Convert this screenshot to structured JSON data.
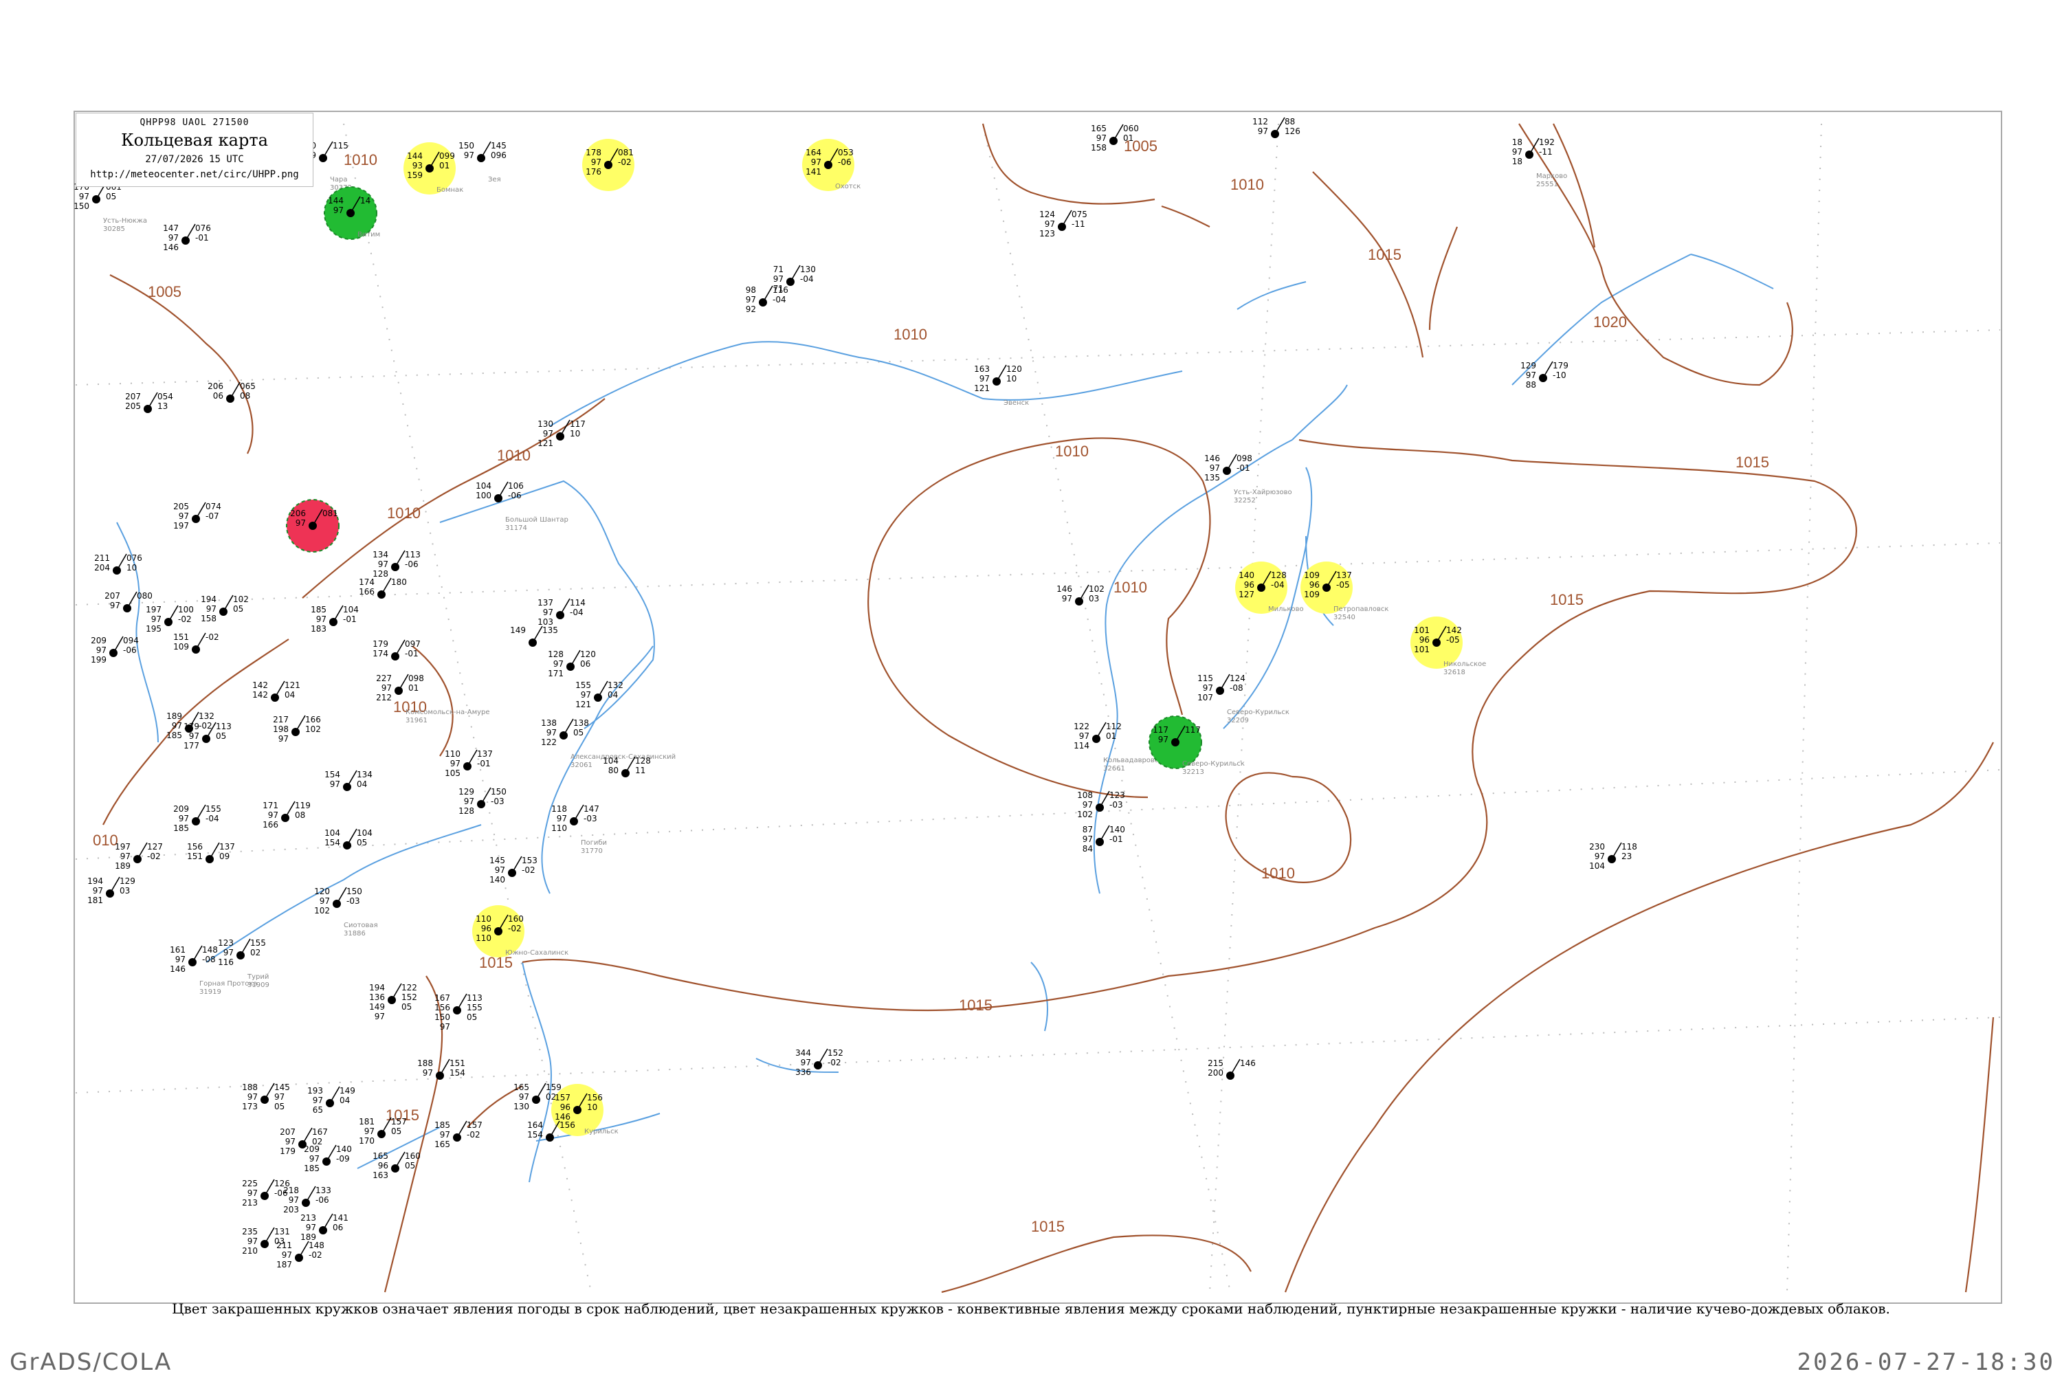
{
  "header": {
    "code": "QHPP98  UAOL  271500",
    "title": "Кольцевая карта",
    "date": "27/07/2026 15 UTC",
    "url": "http://meteocenter.net/circ/UHPP.png"
  },
  "caption": "Цвет закрашенных кружков означает явления погоды в срок наблюдений, цвет незакрашенных кружков - конвективные явления между сроками наблюдений, пунктирные незакрашенные кружки - наличие кучево-дождевых облаков.",
  "footer": {
    "left": "GrADS/COLA",
    "right": "2026-07-27-18:30"
  },
  "colors": {
    "coast": "#5aa0e0",
    "isobar": "#a0522d",
    "green": "#22bb33",
    "yellow": "#ffff66",
    "red": "#ee3355",
    "frame": "#aaaaaa",
    "station_name": "#888888"
  },
  "isobar_labels": [
    "1005",
    "1010",
    "1015",
    "1020",
    "010"
  ],
  "stations": [
    {
      "name": "Усть-Нюкжа",
      "index": "30285",
      "values": [
        "170",
        "97",
        "150",
        "061",
        "05"
      ],
      "marker": "none"
    },
    {
      "name": "",
      "index": "",
      "values": [
        "147",
        "97",
        "146",
        "076",
        "-01"
      ],
      "marker": "none"
    },
    {
      "name": "Чара",
      "index": "30372",
      "values": [
        "140",
        "09",
        "115"
      ],
      "marker": "none"
    },
    {
      "name": "Витим",
      "index": "",
      "values": [
        "144",
        "97",
        "14"
      ],
      "marker": "green"
    },
    {
      "name": "Бомнак",
      "index": "",
      "values": [
        "144",
        "93",
        "159",
        "099",
        "01"
      ],
      "marker": "yellow"
    },
    {
      "name": "Зея",
      "index": "",
      "values": [
        "150",
        "97",
        "145",
        "096"
      ],
      "marker": "none"
    },
    {
      "name": "",
      "index": "",
      "values": [
        "178",
        "97",
        "176",
        "081",
        "-02"
      ],
      "marker": "yellow"
    },
    {
      "name": "Охотск",
      "index": "",
      "values": [
        "164",
        "97",
        "141",
        "053",
        "-06"
      ],
      "marker": "yellow"
    },
    {
      "name": "",
      "index": "",
      "values": [
        "165",
        "97",
        "158",
        "060",
        "01"
      ],
      "marker": "none"
    },
    {
      "name": "",
      "index": "",
      "values": [
        "112",
        "97",
        "88",
        "126"
      ],
      "marker": "none"
    },
    {
      "name": "Марково",
      "index": "25551",
      "values": [
        "18",
        "97",
        "18",
        "192",
        "-11"
      ],
      "marker": "none"
    },
    {
      "name": "",
      "index": "",
      "values": [
        "124",
        "97",
        "123",
        "075",
        "-11"
      ],
      "marker": "none"
    },
    {
      "name": "",
      "index": "",
      "values": [
        "71",
        "97",
        "71",
        "130",
        "-04"
      ],
      "marker": "none"
    },
    {
      "name": "",
      "index": "",
      "values": [
        "98",
        "97",
        "92",
        "116",
        "-04"
      ],
      "marker": "none"
    },
    {
      "name": "Эвенск",
      "index": "",
      "values": [
        "163",
        "97",
        "121",
        "120",
        "10"
      ],
      "marker": "none"
    },
    {
      "name": "",
      "index": "",
      "values": [
        "129",
        "97",
        "88",
        "179",
        "-10"
      ],
      "marker": "none"
    },
    {
      "name": "",
      "index": "",
      "values": [
        "207",
        "205",
        "054",
        "13"
      ],
      "marker": "none"
    },
    {
      "name": "",
      "index": "",
      "values": [
        "206",
        "06",
        "065",
        "08"
      ],
      "marker": "none"
    },
    {
      "name": "",
      "index": "",
      "values": [
        "130",
        "97",
        "121",
        "117",
        "10"
      ],
      "marker": "none"
    },
    {
      "name": "Большой Шантар",
      "index": "31174",
      "values": [
        "104",
        "100",
        "106",
        "-06"
      ],
      "marker": "none"
    },
    {
      "name": "Усть-Хайрюзово",
      "index": "32252",
      "values": [
        "146",
        "97",
        "135",
        "098",
        "-01"
      ],
      "marker": "none"
    },
    {
      "name": "",
      "index": "",
      "values": [
        "205",
        "97",
        "197",
        "074",
        "-07"
      ],
      "marker": "none"
    },
    {
      "name": "",
      "index": "",
      "values": [
        "206",
        "97",
        "081"
      ],
      "marker": "red"
    },
    {
      "name": "",
      "index": "",
      "values": [
        "134",
        "97",
        "128",
        "113",
        "-06"
      ],
      "marker": "none"
    },
    {
      "name": "",
      "index": "",
      "values": [
        "211",
        "204",
        "076",
        "10"
      ],
      "marker": "none"
    },
    {
      "name": "",
      "index": "",
      "values": [
        "207",
        "97",
        "080"
      ],
      "marker": "none"
    },
    {
      "name": "",
      "index": "",
      "values": [
        "197",
        "97",
        "195",
        "100",
        "-02"
      ],
      "marker": "none"
    },
    {
      "name": "",
      "index": "",
      "values": [
        "194",
        "97",
        "158",
        "102",
        "05"
      ],
      "marker": "none"
    },
    {
      "name": "",
      "index": "",
      "values": [
        "174",
        "166",
        "180"
      ],
      "marker": "none"
    },
    {
      "name": "",
      "index": "",
      "values": [
        "137",
        "97",
        "103",
        "114",
        "-04"
      ],
      "marker": "none"
    },
    {
      "name": "",
      "index": "",
      "values": [
        "149",
        "135"
      ],
      "marker": "none"
    },
    {
      "name": "Мильково",
      "index": "",
      "values": [
        "140",
        "96",
        "127",
        "128",
        "-04"
      ],
      "marker": "yellow"
    },
    {
      "name": "Петропавловск",
      "index": "32540",
      "values": [
        "109",
        "96",
        "109",
        "137",
        "-05"
      ],
      "marker": "yellow"
    },
    {
      "name": "",
      "index": "",
      "values": [
        "146",
        "97",
        "102",
        "03"
      ],
      "marker": "none"
    },
    {
      "name": "Никольское",
      "index": "32618",
      "values": [
        "101",
        "96",
        "101",
        "142",
        "-05"
      ],
      "marker": "yellow"
    },
    {
      "name": "",
      "index": "",
      "values": [
        "209",
        "97",
        "199",
        "094",
        "-06"
      ],
      "marker": "none"
    },
    {
      "name": "",
      "index": "",
      "values": [
        "151",
        "109",
        "-02"
      ],
      "marker": "none"
    },
    {
      "name": "",
      "index": "",
      "values": [
        "185",
        "97",
        "183",
        "104",
        "-01"
      ],
      "marker": "none"
    },
    {
      "name": "",
      "index": "",
      "values": [
        "179",
        "174",
        "097",
        "-01"
      ],
      "marker": "none"
    },
    {
      "name": "",
      "index": "",
      "values": [
        "128",
        "97",
        "171",
        "120",
        "06"
      ],
      "marker": "none"
    },
    {
      "name": "Северо-Курильск",
      "index": "32209",
      "values": [
        "115",
        "97",
        "107",
        "124",
        "-08"
      ],
      "marker": "none"
    },
    {
      "name": "",
      "index": "",
      "values": [
        "142",
        "142",
        "121",
        "04"
      ],
      "marker": "none"
    },
    {
      "name": "Комсомольск-на-Амуре",
      "index": "31961",
      "values": [
        "227",
        "97",
        "212",
        "098",
        "01"
      ],
      "marker": "none"
    },
    {
      "name": "",
      "index": "",
      "values": [
        "155",
        "97",
        "121",
        "132",
        "04"
      ],
      "marker": "none"
    },
    {
      "name": "",
      "index": "",
      "values": [
        "189",
        "97",
        "185",
        "132",
        "-02"
      ],
      "marker": "none"
    },
    {
      "name": "",
      "index": "",
      "values": [
        "179",
        "97",
        "177",
        "113",
        "05"
      ],
      "marker": "none"
    },
    {
      "name": "",
      "index": "",
      "values": [
        "217",
        "198",
        "97",
        "166",
        "102"
      ],
      "marker": "none"
    },
    {
      "name": "",
      "index": "",
      "values": [
        "154",
        "97",
        "134",
        "04"
      ],
      "marker": "none"
    },
    {
      "name": "Александровск-Сахалинский",
      "index": "32061",
      "values": [
        "138",
        "97",
        "122",
        "138",
        "05"
      ],
      "marker": "none"
    },
    {
      "name": "",
      "index": "",
      "values": [
        "104",
        "80",
        "128",
        "11"
      ],
      "marker": "none"
    },
    {
      "name": "Кольвадаврово",
      "index": "32661",
      "values": [
        "122",
        "97",
        "114",
        "112",
        "01"
      ],
      "marker": "none"
    },
    {
      "name": "Северо-Курильск",
      "index": "32213",
      "values": [
        "117",
        "97",
        "117"
      ],
      "marker": "green"
    },
    {
      "name": "",
      "index": "",
      "values": [
        "110",
        "97",
        "105",
        "137",
        "-01"
      ],
      "marker": "none"
    },
    {
      "name": "",
      "index": "",
      "values": [
        "209",
        "97",
        "185",
        "155",
        "-04"
      ],
      "marker": "none"
    },
    {
      "name": "",
      "index": "",
      "values": [
        "171",
        "97",
        "166",
        "119",
        "08"
      ],
      "marker": "none"
    },
    {
      "name": "",
      "index": "",
      "values": [
        "129",
        "97",
        "128",
        "150",
        "-03"
      ],
      "marker": "none"
    },
    {
      "name": "Погиби",
      "index": "31770",
      "values": [
        "118",
        "97",
        "110",
        "147",
        "-03"
      ],
      "marker": "none"
    },
    {
      "name": "",
      "index": "",
      "values": [
        "108",
        "97",
        "102",
        "123",
        "-03"
      ],
      "marker": "none"
    },
    {
      "name": "",
      "index": "",
      "values": [
        "87",
        "97",
        "84",
        "140",
        "-01"
      ],
      "marker": "none"
    },
    {
      "name": "",
      "index": "",
      "values": [
        "197",
        "97",
        "189",
        "127",
        "-02"
      ],
      "marker": "none"
    },
    {
      "name": "",
      "index": "",
      "values": [
        "156",
        "151",
        "137",
        "09"
      ],
      "marker": "none"
    },
    {
      "name": "",
      "index": "",
      "values": [
        "104",
        "154",
        "104",
        "05"
      ],
      "marker": "none"
    },
    {
      "name": "",
      "index": "",
      "values": [
        "145",
        "97",
        "140",
        "153",
        "-02"
      ],
      "marker": "none"
    },
    {
      "name": "",
      "index": "",
      "values": [
        "230",
        "97",
        "104",
        "118",
        "23"
      ],
      "marker": "none"
    },
    {
      "name": "",
      "index": "",
      "values": [
        "194",
        "97",
        "181",
        "129",
        "03"
      ],
      "marker": "none"
    },
    {
      "name": "Сиотовая",
      "index": "31886",
      "values": [
        "120",
        "97",
        "102",
        "150",
        "-03"
      ],
      "marker": "none"
    },
    {
      "name": "Южно-Сахалинск",
      "index": "",
      "values": [
        "110",
        "96",
        "110",
        "160",
        "-02"
      ],
      "marker": "yellow"
    },
    {
      "name": "Горная Протока",
      "index": "31919",
      "values": [
        "161",
        "97",
        "146",
        "148",
        "-08"
      ],
      "marker": "none"
    },
    {
      "name": "Турий",
      "index": "31909",
      "values": [
        "123",
        "97",
        "116",
        "155",
        "02"
      ],
      "marker": "none"
    },
    {
      "name": "",
      "index": "",
      "values": [
        "194",
        "136",
        "149",
        "97",
        "122",
        "152",
        "05"
      ],
      "marker": "none"
    },
    {
      "name": "",
      "index": "",
      "values": [
        "167",
        "156",
        "150",
        "97",
        "113",
        "155",
        "05"
      ],
      "marker": "none"
    },
    {
      "name": "",
      "index": "",
      "values": [
        "344",
        "97",
        "336",
        "152",
        "-02"
      ],
      "marker": "none"
    },
    {
      "name": "",
      "index": "",
      "values": [
        "215",
        "200",
        "146"
      ],
      "marker": "none"
    },
    {
      "name": "",
      "index": "",
      "values": [
        "188",
        "97",
        "151",
        "154"
      ],
      "marker": "none"
    },
    {
      "name": "Курильск",
      "index": "",
      "values": [
        "157",
        "96",
        "146",
        "156",
        "10"
      ],
      "marker": "yellow"
    },
    {
      "name": "",
      "index": "",
      "values": [
        "165",
        "97",
        "130",
        "159",
        "02"
      ],
      "marker": "none"
    },
    {
      "name": "",
      "index": "",
      "values": [
        "188",
        "97",
        "173",
        "145",
        "97",
        "05"
      ],
      "marker": "none"
    },
    {
      "name": "",
      "index": "",
      "values": [
        "193",
        "97",
        "65",
        "149",
        "04"
      ],
      "marker": "none"
    },
    {
      "name": "",
      "index": "",
      "values": [
        "207",
        "97",
        "179",
        "167",
        "02"
      ],
      "marker": "none"
    },
    {
      "name": "",
      "index": "",
      "values": [
        "209",
        "97",
        "185",
        "140",
        "-09"
      ],
      "marker": "none"
    },
    {
      "name": "",
      "index": "",
      "values": [
        "181",
        "97",
        "170",
        "157",
        "05"
      ],
      "marker": "none"
    },
    {
      "name": "",
      "index": "",
      "values": [
        "185",
        "97",
        "165",
        "157",
        "-02"
      ],
      "marker": "none"
    },
    {
      "name": "",
      "index": "",
      "values": [
        "164",
        "154",
        "156"
      ],
      "marker": "none"
    },
    {
      "name": "",
      "index": "",
      "values": [
        "165",
        "96",
        "163",
        "160",
        "05"
      ],
      "marker": "none"
    },
    {
      "name": "",
      "index": "",
      "values": [
        "225",
        "97",
        "213",
        "126",
        "-06"
      ],
      "marker": "none"
    },
    {
      "name": "",
      "index": "",
      "values": [
        "218",
        "97",
        "203",
        "133",
        "-06"
      ],
      "marker": "none"
    },
    {
      "name": "",
      "index": "",
      "values": [
        "213",
        "97",
        "189",
        "141",
        "06"
      ],
      "marker": "none"
    },
    {
      "name": "",
      "index": "",
      "values": [
        "235",
        "97",
        "210",
        "131",
        "03"
      ],
      "marker": "none"
    },
    {
      "name": "",
      "index": "",
      "values": [
        "211",
        "97",
        "187",
        "148",
        "-02"
      ],
      "marker": "none"
    }
  ]
}
